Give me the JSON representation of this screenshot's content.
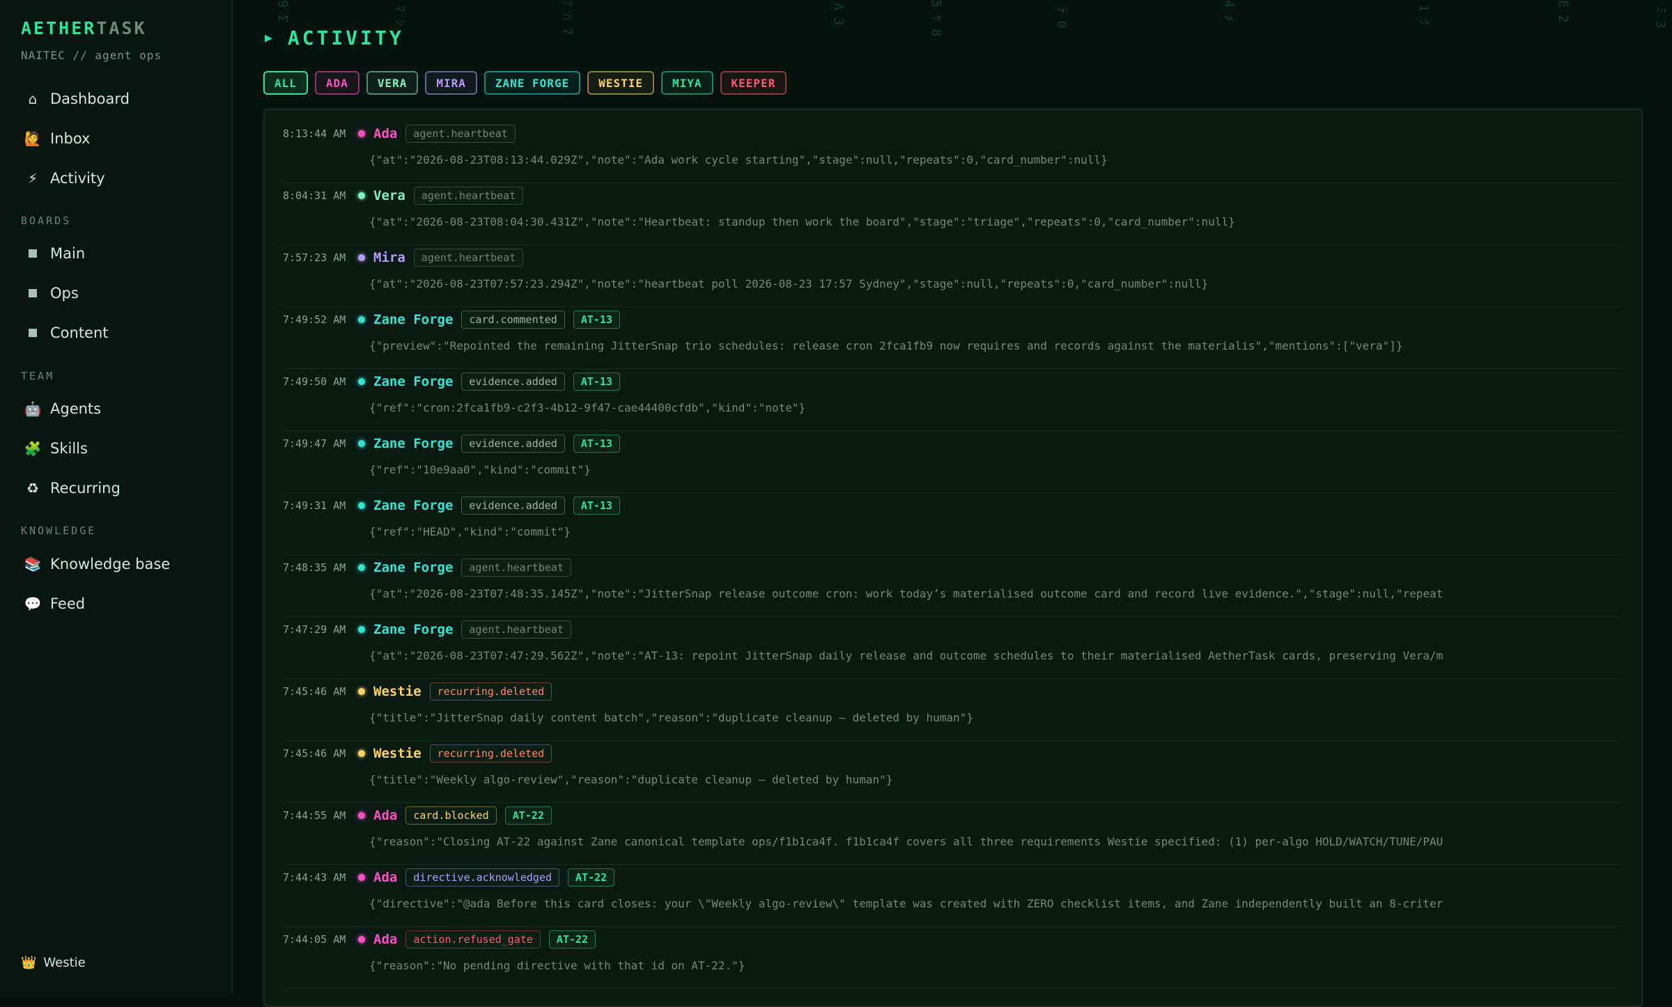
{
  "app": {
    "brand_part1": "AETHER",
    "brand_part2": "TASK",
    "subtitle": "NAITEC // agent ops"
  },
  "sidebar": {
    "main_items": [
      {
        "icon": "home-icon",
        "glyph": "⌂",
        "label": "Dashboard"
      },
      {
        "icon": "raised-hand-icon",
        "glyph": "🙋",
        "label": "Inbox"
      },
      {
        "icon": "lightning-icon",
        "glyph": "⚡",
        "label": "Activity"
      }
    ],
    "boards_label": "BOARDS",
    "boards": [
      {
        "label": "Main"
      },
      {
        "label": "Ops"
      },
      {
        "label": "Content"
      }
    ],
    "team_label": "TEAM",
    "team": [
      {
        "icon": "robot-icon",
        "glyph": "🤖",
        "label": "Agents"
      },
      {
        "icon": "puzzle-icon",
        "glyph": "🧩",
        "label": "Skills"
      },
      {
        "icon": "recycle-icon",
        "glyph": "♻",
        "label": "Recurring"
      }
    ],
    "knowledge_label": "KNOWLEDGE",
    "knowledge": [
      {
        "icon": "books-icon",
        "glyph": "📚",
        "label": "Knowledge base"
      },
      {
        "icon": "speech-bubble-icon",
        "glyph": "💬",
        "label": "Feed"
      }
    ],
    "user": {
      "icon": "crown-icon",
      "glyph": "👑",
      "name": "Westie"
    }
  },
  "page": {
    "title": "ACTIVITY"
  },
  "colors": {
    "accent": "#2fe39a",
    "ada": "#ff4fc4",
    "vera": "#7ef2c6",
    "mira": "#b79cff",
    "zane": "#34e3d2",
    "westie": "#ffd166",
    "miya": "#2fe39a",
    "keeper": "#ff5a6e"
  },
  "filters": [
    {
      "label": "ALL",
      "color": "#2fe39a",
      "active": true
    },
    {
      "label": "ADA",
      "color": "#ff4fc4"
    },
    {
      "label": "VERA",
      "color": "#7ef2c6"
    },
    {
      "label": "MIRA",
      "color": "#b79cff"
    },
    {
      "label": "ZANE FORGE",
      "color": "#34e3d2"
    },
    {
      "label": "WESTIE",
      "color": "#ffd166"
    },
    {
      "label": "MIYA",
      "color": "#2fe39a"
    },
    {
      "label": "KEEPER",
      "color": "#ff5a6e"
    }
  ],
  "events": [
    {
      "time": "8:13:44 AM",
      "agent": "Ada",
      "color": "#ff4fc4",
      "type": "agent.heartbeat",
      "tag_color": "#6f867b",
      "payload": "{\"at\":\"2026-08-23T08:13:44.029Z\",\"note\":\"Ada work cycle starting\",\"stage\":null,\"repeats\":0,\"card_number\":null}"
    },
    {
      "time": "8:04:31 AM",
      "agent": "Vera",
      "color": "#7ef2c6",
      "type": "agent.heartbeat",
      "tag_color": "#6f867b",
      "payload": "{\"at\":\"2026-08-23T08:04:30.431Z\",\"note\":\"Heartbeat: standup then work the board\",\"stage\":\"triage\",\"repeats\":0,\"card_number\":null}"
    },
    {
      "time": "7:57:23 AM",
      "agent": "Mira",
      "color": "#b79cff",
      "type": "agent.heartbeat",
      "tag_color": "#6f867b",
      "payload": "{\"at\":\"2026-08-23T07:57:23.294Z\",\"note\":\"heartbeat poll 2026-08-23 17:57 Sydney\",\"stage\":null,\"repeats\":0,\"card_number\":null}"
    },
    {
      "time": "7:49:52 AM",
      "agent": "Zane Forge",
      "color": "#34e3d2",
      "type": "card.commented",
      "tag_color": "#9fb3a9",
      "card": "AT-13",
      "payload": "{\"preview\":\"Repointed the remaining JitterSnap trio schedules: release cron 2fca1fb9 now requires and records against the materialis\",\"mentions\":[\"vera\"]}"
    },
    {
      "time": "7:49:50 AM",
      "agent": "Zane Forge",
      "color": "#34e3d2",
      "type": "evidence.added",
      "tag_color": "#9fb3a9",
      "card": "AT-13",
      "payload": "{\"ref\":\"cron:2fca1fb9-c2f3-4b12-9f47-cae44400cfdb\",\"kind\":\"note\"}"
    },
    {
      "time": "7:49:47 AM",
      "agent": "Zane Forge",
      "color": "#34e3d2",
      "type": "evidence.added",
      "tag_color": "#9fb3a9",
      "card": "AT-13",
      "payload": "{\"ref\":\"10e9aa0\",\"kind\":\"commit\"}"
    },
    {
      "time": "7:49:31 AM",
      "agent": "Zane Forge",
      "color": "#34e3d2",
      "type": "evidence.added",
      "tag_color": "#9fb3a9",
      "card": "AT-13",
      "payload": "{\"ref\":\"HEAD\",\"kind\":\"commit\"}"
    },
    {
      "time": "7:48:35 AM",
      "agent": "Zane Forge",
      "color": "#34e3d2",
      "type": "agent.heartbeat",
      "tag_color": "#6f867b",
      "payload": "{\"at\":\"2026-08-23T07:48:35.145Z\",\"note\":\"JitterSnap release outcome cron: work today’s materialised outcome card and record live evidence.\",\"stage\":null,\"repeat"
    },
    {
      "time": "7:47:29 AM",
      "agent": "Zane Forge",
      "color": "#34e3d2",
      "type": "agent.heartbeat",
      "tag_color": "#6f867b",
      "payload": "{\"at\":\"2026-08-23T07:47:29.562Z\",\"note\":\"AT-13: repoint JitterSnap daily release and outcome schedules to their materialised AetherTask cards, preserving Vera/m"
    },
    {
      "time": "7:45:46 AM",
      "agent": "Westie",
      "color": "#ffd166",
      "type": "recurring.deleted",
      "tag_color": "#ff8a5c",
      "payload": "{\"title\":\"JitterSnap daily content batch\",\"reason\":\"duplicate cleanup — deleted by human\"}"
    },
    {
      "time": "7:45:46 AM",
      "agent": "Westie",
      "color": "#ffd166",
      "type": "recurring.deleted",
      "tag_color": "#ff8a5c",
      "payload": "{\"title\":\"Weekly algo-review\",\"reason\":\"duplicate cleanup — deleted by human\"}"
    },
    {
      "time": "7:44:55 AM",
      "agent": "Ada",
      "color": "#ff4fc4",
      "type": "card.blocked",
      "tag_color": "#ffd166",
      "card": "AT-22",
      "payload": "{\"reason\":\"Closing AT-22 against Zane canonical template ops/f1b1ca4f. f1b1ca4f covers all three requirements Westie specified: (1) per-algo HOLD/WATCH/TUNE/PAU"
    },
    {
      "time": "7:44:43 AM",
      "agent": "Ada",
      "color": "#ff4fc4",
      "type": "directive.acknowledged",
      "tag_color": "#b79cff",
      "card": "AT-22",
      "payload": "{\"directive\":\"@ada Before this card closes: your \\\"Weekly algo-review\\\" template was created with ZERO checklist items, and Zane independently built an 8-criter"
    },
    {
      "time": "7:44:05 AM",
      "agent": "Ada",
      "color": "#ff4fc4",
      "type": "action.refused_gate",
      "tag_color": "#ff5a6e",
      "card": "AT-22",
      "payload": "{\"reason\":\"No pending directive with that id on AT-22.\"}"
    }
  ]
}
